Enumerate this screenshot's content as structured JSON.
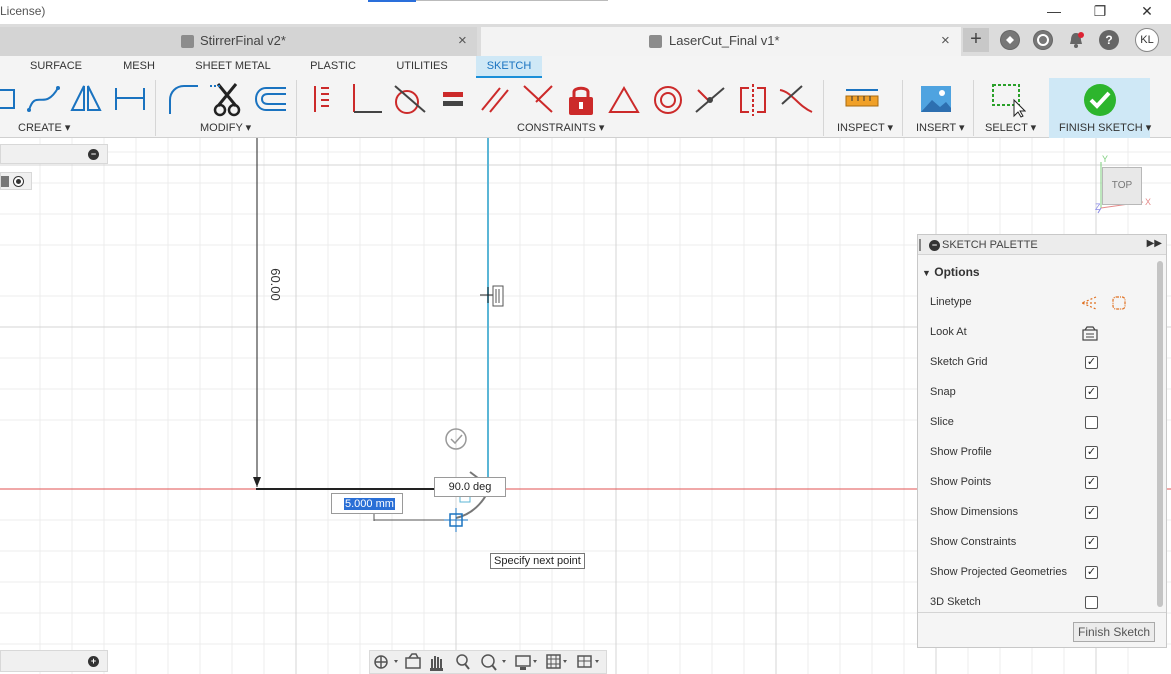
{
  "window": {
    "title_fragment": "License)",
    "minimize": "—",
    "restore": "❐",
    "close": "✕"
  },
  "tabs": {
    "inactive": {
      "label": "StirrerFinal v2*",
      "close": "×"
    },
    "active": {
      "label": "LaserCut_Final v1*",
      "close": "×"
    },
    "new_tab": "+",
    "user_initials": "KL"
  },
  "ribbon": {
    "tabs": [
      "SURFACE",
      "MESH",
      "SHEET METAL",
      "PLASTIC",
      "UTILITIES",
      "SKETCH"
    ],
    "active_tab": "SKETCH",
    "groups": {
      "create": "CREATE ▾",
      "modify": "MODIFY ▾",
      "constraints": "CONSTRAINTS ▾",
      "inspect": "INSPECT ▾",
      "insert": "INSERT ▾",
      "select": "SELECT ▾",
      "finish": "FINISH SKETCH ▾"
    }
  },
  "canvas": {
    "vertical_dimension": "60.00",
    "length_input": "5.000 mm",
    "angle_value": "90.0 deg",
    "tooltip": "Specify next point",
    "viewcube_label": "TOP",
    "axis_y": "Y",
    "axis_x": "X",
    "axis_z": "Z"
  },
  "palette": {
    "title": "SKETCH PALETTE",
    "section": "Options",
    "rows": [
      {
        "label": "Linetype",
        "type": "icons"
      },
      {
        "label": "Look At",
        "type": "icon"
      },
      {
        "label": "Sketch Grid",
        "checked": true
      },
      {
        "label": "Snap",
        "checked": true
      },
      {
        "label": "Slice",
        "checked": false
      },
      {
        "label": "Show Profile",
        "checked": true
      },
      {
        "label": "Show Points",
        "checked": true
      },
      {
        "label": "Show Dimensions",
        "checked": true
      },
      {
        "label": "Show Constraints",
        "checked": true
      },
      {
        "label": "Show Projected Geometries",
        "checked": true
      },
      {
        "label": "3D Sketch",
        "checked": false
      }
    ],
    "finish_button": "Finish Sketch"
  },
  "colors": {
    "accent_blue": "#1a8fd8",
    "finish_green": "#2db52d",
    "x_axis_red": "#e05252",
    "y_axis_cyan": "#5bb6d6",
    "constraint_red": "#cc2a2a"
  }
}
